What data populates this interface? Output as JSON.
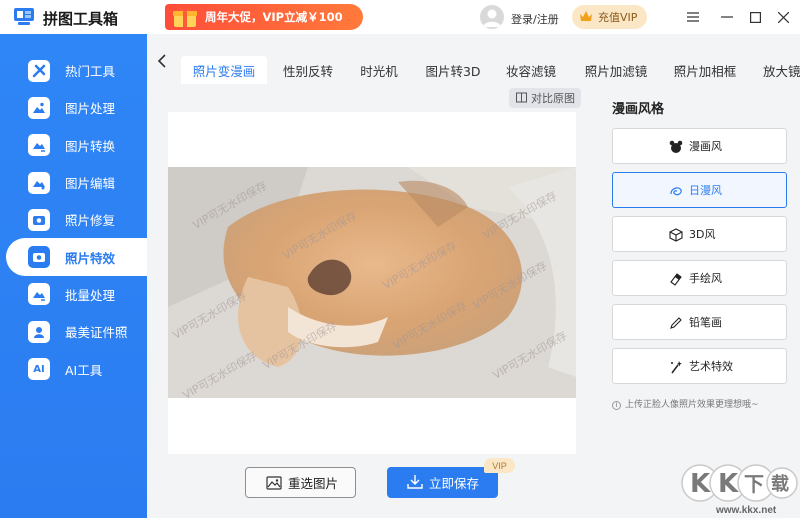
{
  "app": {
    "title": "拼图工具箱"
  },
  "promo": {
    "text": "周年大促，VIP立减￥100"
  },
  "header": {
    "login": "登录/注册",
    "vip": "充值VIP"
  },
  "sidebar": {
    "items": [
      {
        "label": "热门工具",
        "icon": "hot-tools-icon"
      },
      {
        "label": "图片处理",
        "icon": "image-process-icon"
      },
      {
        "label": "图片转换",
        "icon": "image-convert-icon"
      },
      {
        "label": "图片编辑",
        "icon": "image-edit-icon"
      },
      {
        "label": "照片修复",
        "icon": "photo-repair-icon"
      },
      {
        "label": "照片特效",
        "icon": "photo-effect-icon",
        "active": true
      },
      {
        "label": "批量处理",
        "icon": "batch-icon"
      },
      {
        "label": "最美证件照",
        "icon": "id-photo-icon"
      },
      {
        "label": "AI工具",
        "icon": "ai-icon"
      }
    ]
  },
  "tabs": [
    "照片变漫画",
    "性别反转",
    "时光机",
    "图片转3D",
    "妆容滤镜",
    "照片加滤镜",
    "照片加相框",
    "放大镜"
  ],
  "main": {
    "compare": "对比原图",
    "watermark": "VIP可无水印保存",
    "reselect": "重选图片",
    "save": "立即保存",
    "vip_tag": "VIP"
  },
  "panel": {
    "title": "漫画风格",
    "options": [
      "漫画风",
      "日漫风",
      "3D风",
      "手绘风",
      "铅笔画",
      "艺术特效"
    ],
    "selected_index": 1,
    "hint": "上传正脸人像照片效果更理想哦~"
  },
  "site_watermark": {
    "logo": "KK下载",
    "url": "www.kkx.net"
  },
  "colors": {
    "accent": "#2b7cf0",
    "promo": "#ff4d3a",
    "vip_bg": "#fbe7c6"
  }
}
